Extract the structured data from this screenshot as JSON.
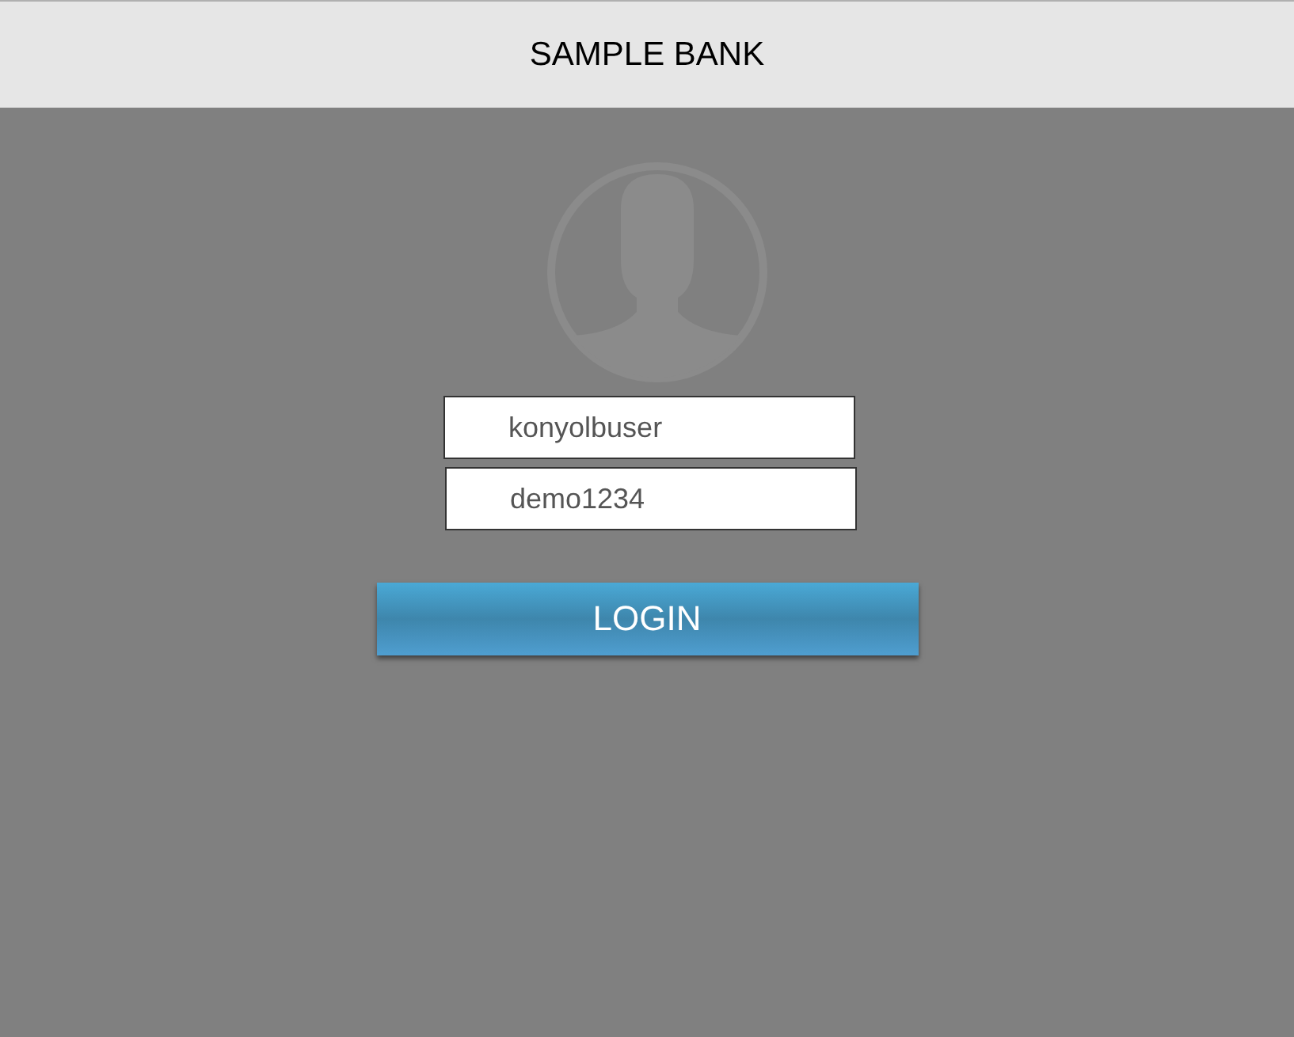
{
  "header": {
    "title": "SAMPLE BANK"
  },
  "login_form": {
    "username": {
      "value": "konyolbuser"
    },
    "password": {
      "value": "demo1234"
    },
    "button": {
      "label": "LOGIN"
    }
  }
}
